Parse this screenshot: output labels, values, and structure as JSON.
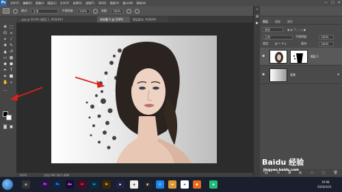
{
  "app": {
    "logo": "Ps",
    "menu": [
      "文件(F)",
      "编辑(E)",
      "图像(I)",
      "图层(L)",
      "文字(Y)",
      "选择(S)",
      "滤镜(T)",
      "3D(D)",
      "视图(V)",
      "窗口(W)",
      "帮助(H)"
    ],
    "window_controls": [
      "—",
      "□",
      "×"
    ]
  },
  "options_bar": {
    "mode_label": "模式:",
    "mode_value": "正常",
    "opacity_label": "不透明度:",
    "opacity_value": "100%",
    "flow_label": "流量:",
    "flow_value": "100%"
  },
  "document_tabs": [
    {
      "label": "…jpg @ 50.6% (图层 1, RGB/8#)",
      "active": false
    },
    {
      "label": "未标题-1 @ 100%",
      "active": true
    },
    {
      "label": "图层副本, RGB/8#",
      "active": false
    }
  ],
  "status_bar": {
    "zoom": "100%",
    "doc_info": "文档:596.3K/1.48M"
  },
  "layers_panel": {
    "tabs": [
      "图层",
      "通道",
      "路径"
    ],
    "kind_label": "类型",
    "blend_mode": "正常",
    "opacity_label": "不透明度:",
    "opacity_value": "100%",
    "lock_label": "锁定:",
    "fill_label": "填充:",
    "fill_value": "100%",
    "layers": [
      {
        "name": "图层 1",
        "selected": true
      },
      {
        "name": "背景",
        "selected": false
      }
    ],
    "bottom_icons": [
      "link-icon",
      "fx-icon",
      "mask-icon",
      "adjustment-icon",
      "group-icon",
      "new-layer-icon",
      "trash-icon"
    ]
  },
  "taskbar": {
    "apps": [
      "Pr",
      "Ps",
      "Ae",
      "Id",
      "Lr",
      "Br"
    ],
    "tray_time": "19:08",
    "tray_date": "2020/4/24"
  },
  "watermark": {
    "brand": "Baidu 经验",
    "url": "jingyan.baidu.com"
  },
  "colors": {
    "annotation_arrow": "#d8221c",
    "ps_blue": "#2a66a8",
    "foreground": "#000000",
    "background": "#ffffff"
  }
}
